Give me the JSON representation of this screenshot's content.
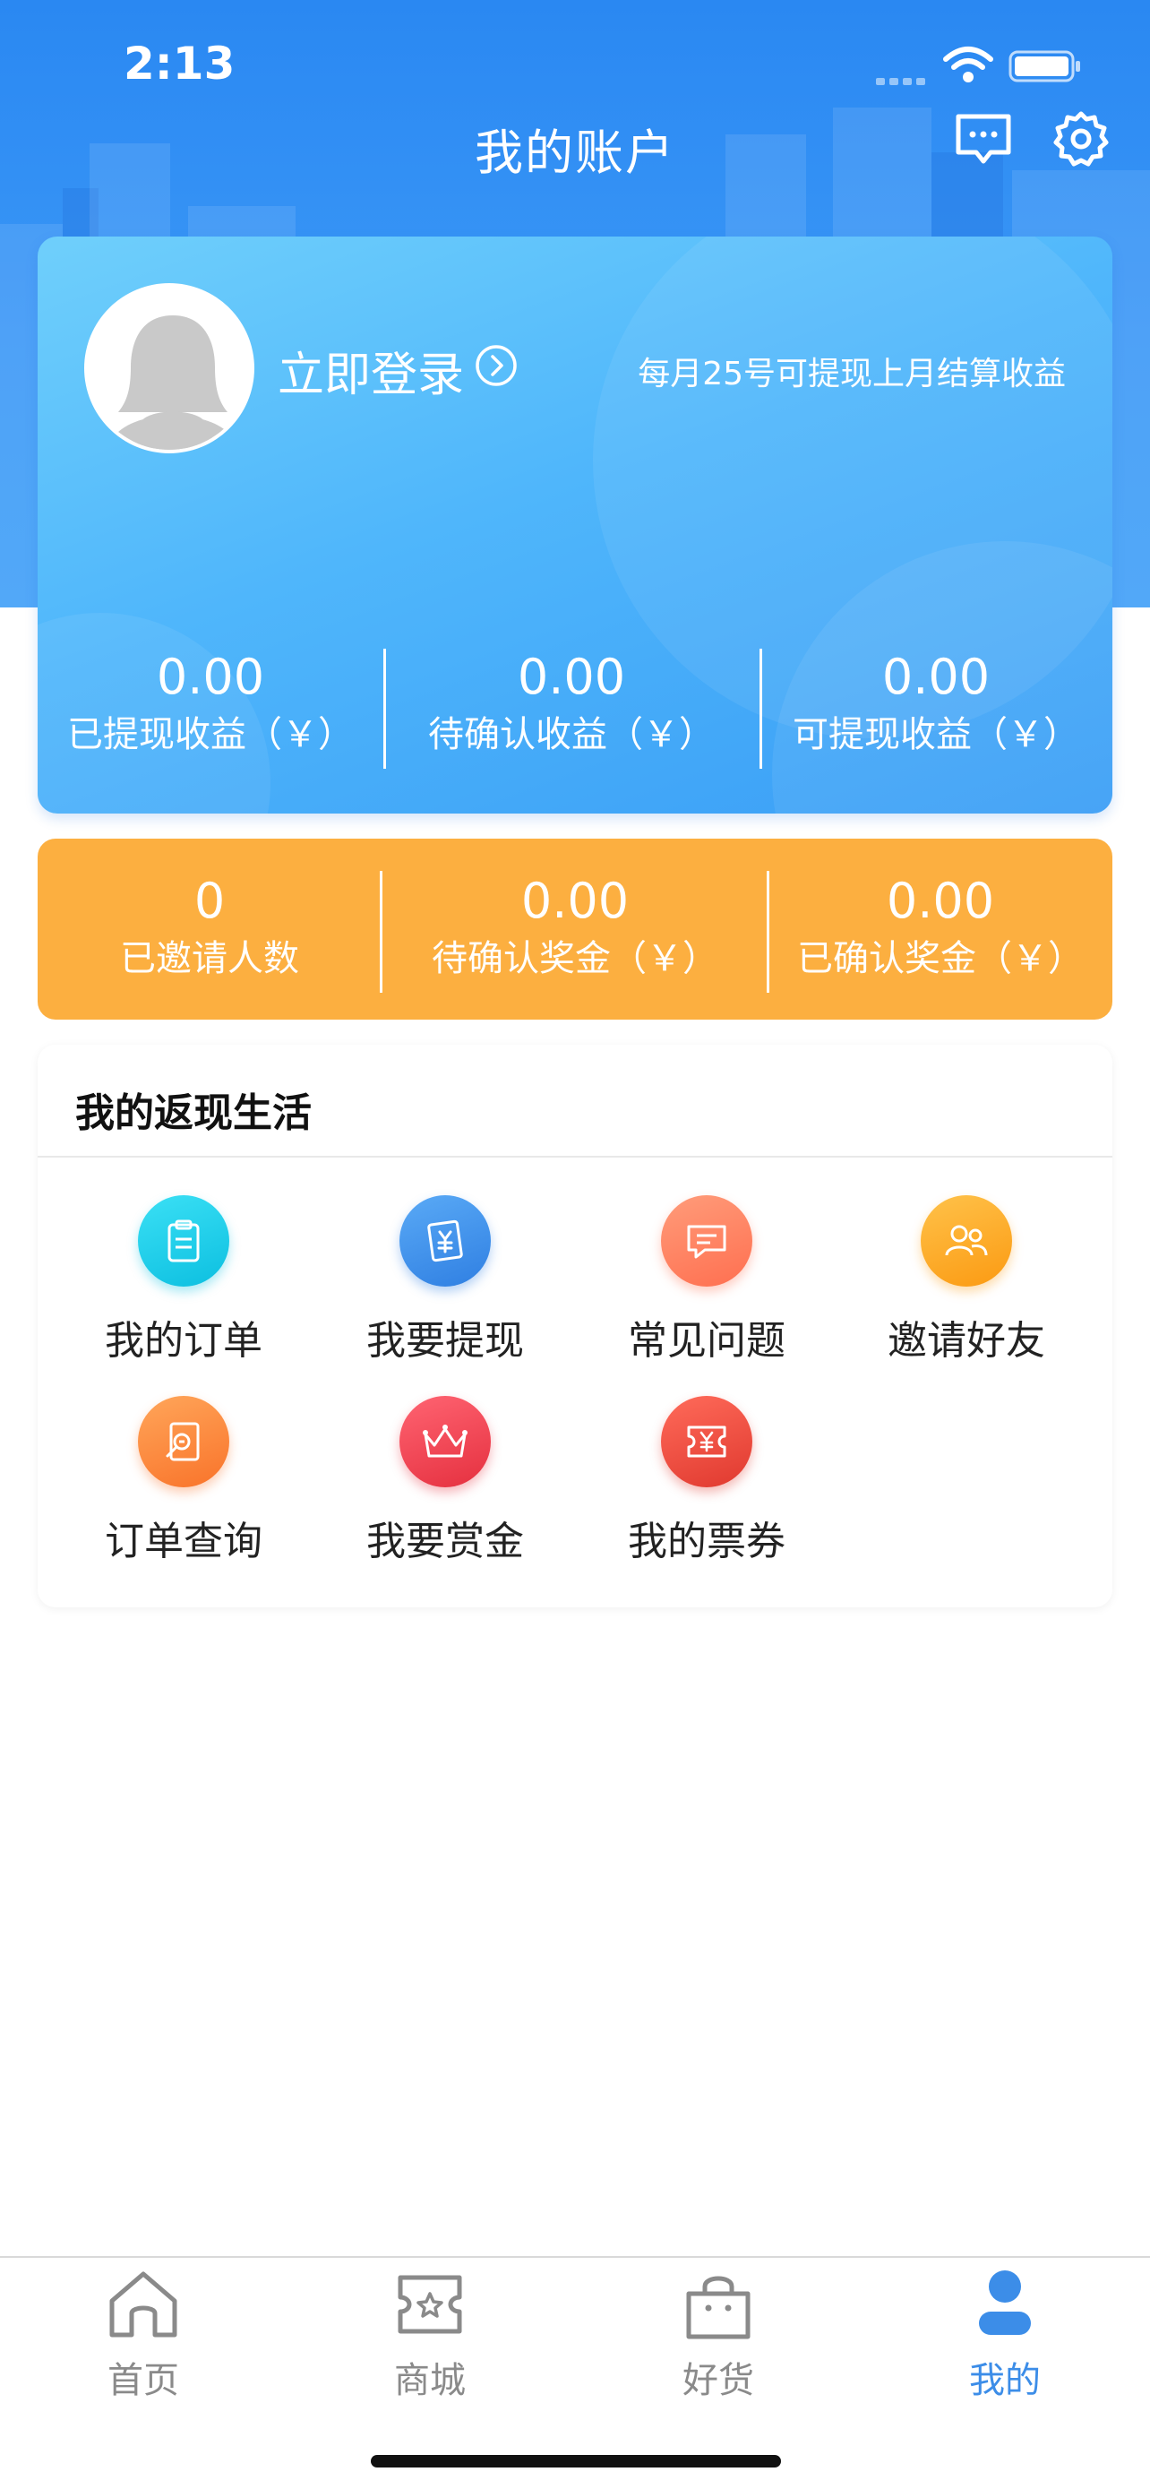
{
  "status_bar": {
    "time": "2:13"
  },
  "header": {
    "title": "我的账户"
  },
  "account": {
    "login_label": "立即登录",
    "withdraw_note": "每月25号可提现上月结算收益",
    "stats": [
      {
        "value": "0.00",
        "label": "已提现收益（￥）"
      },
      {
        "value": "0.00",
        "label": "待确认收益（￥）"
      },
      {
        "value": "0.00",
        "label": "可提现收益（￥）"
      }
    ]
  },
  "invite": {
    "stats": [
      {
        "value": "0",
        "label": "已邀请人数"
      },
      {
        "value": "0.00",
        "label": "待确认奖金（￥）"
      },
      {
        "value": "0.00",
        "label": "已确认奖金（￥）"
      }
    ]
  },
  "cashback": {
    "title": "我的返现生活",
    "items": [
      {
        "label": "我的订单",
        "icon": "clipboard-icon",
        "color": "#12c8e6"
      },
      {
        "label": "我要提现",
        "icon": "receipt-yuan-icon",
        "color": "#3f8fec"
      },
      {
        "label": "常见问题",
        "icon": "chat-bubble-icon",
        "color": "#ff7f5e"
      },
      {
        "label": "邀请好友",
        "icon": "people-icon",
        "color": "#fca629"
      },
      {
        "label": "订单查询",
        "icon": "search-document-icon",
        "color": "#fb8838"
      },
      {
        "label": "我要赏金",
        "icon": "vip-crown-icon",
        "color": "#f1485a"
      },
      {
        "label": "我的票券",
        "icon": "ticket-yuan-icon",
        "color": "#ee5349"
      }
    ]
  },
  "tabbar": {
    "tabs": [
      {
        "label": "首页",
        "icon": "home-icon"
      },
      {
        "label": "商城",
        "icon": "store-ticket-icon"
      },
      {
        "label": "好货",
        "icon": "shopping-bag-icon"
      },
      {
        "label": "我的",
        "icon": "user-icon"
      }
    ],
    "active_color": "#3c8de8",
    "inactive_color": "#8a8a8a"
  }
}
